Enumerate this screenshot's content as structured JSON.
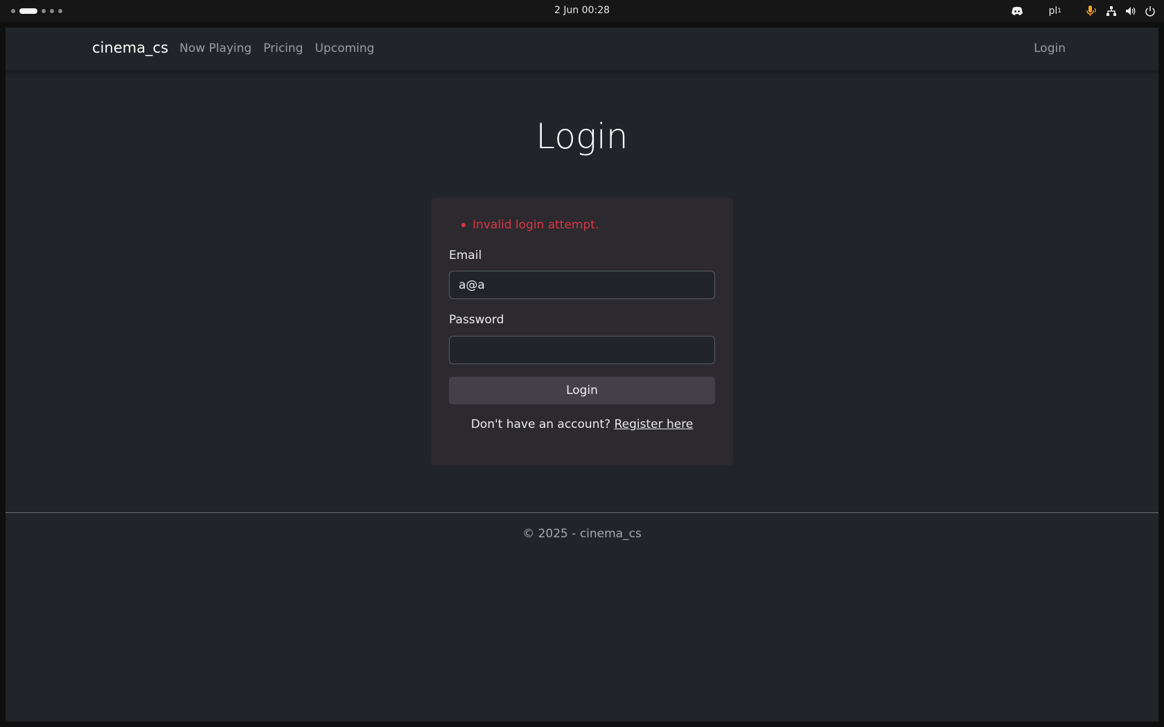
{
  "system_bar": {
    "clock": "2 Jun  00:28",
    "language": "pl",
    "language_sub": "1",
    "icons": [
      "discord-icon",
      "microphone-icon",
      "network-icon",
      "volume-icon",
      "power-icon"
    ],
    "mic_color": "#f5a623"
  },
  "navbar": {
    "brand": "cinema_cs",
    "links": [
      {
        "label": "Now Playing"
      },
      {
        "label": "Pricing"
      },
      {
        "label": "Upcoming"
      }
    ],
    "login": "Login"
  },
  "main": {
    "title": "Login",
    "errors": [
      "Invalid login attempt."
    ],
    "email_label": "Email",
    "email_value": "a@a",
    "password_label": "Password",
    "password_value": "",
    "submit_label": "Login",
    "register_prompt": "Don't have an account?",
    "register_link": "Register here"
  },
  "footer": {
    "text": "© 2025 - cinema_cs"
  },
  "colors": {
    "background": "#212529",
    "card": "#2c2a2e",
    "error": "#dc3545",
    "button": "#434147"
  }
}
